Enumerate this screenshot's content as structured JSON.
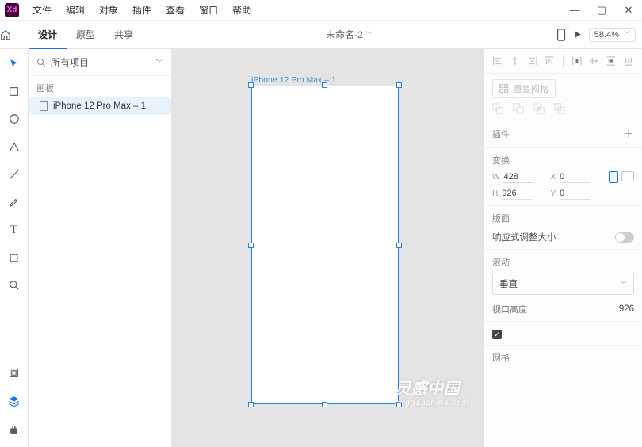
{
  "app_badge": "Xd",
  "menu": {
    "file": "文件",
    "edit": "编辑",
    "object": "对象",
    "plugins": "插件",
    "view": "查看",
    "window": "窗口",
    "help": "帮助"
  },
  "modes": {
    "design": "设计",
    "prototype": "原型",
    "share": "共享"
  },
  "doc": {
    "name": "未命名-2"
  },
  "zoom": "58.4%",
  "layers": {
    "search_placeholder": "所有项目",
    "section": "画板",
    "artboard_name": "iPhone 12 Pro Max – 1"
  },
  "canvas": {
    "artboard_label": "iPhone 12 Pro Max – 1"
  },
  "props": {
    "repeat_grid": "重复网格",
    "plugins": "插件",
    "transform": "变换",
    "w_label": "W",
    "w_value": "428",
    "h_label": "H",
    "h_value": "926",
    "x_label": "X",
    "x_value": "0",
    "y_label": "Y",
    "y_value": "0",
    "layout": "版面",
    "responsive": "响应式调整大小",
    "scroll": "滚动",
    "scroll_value": "垂直",
    "viewport_label": "视口高度",
    "viewport_value": "926",
    "appearance": "网格"
  },
  "watermark": {
    "main": "灵感中国",
    "sub": "lingganchina.com"
  }
}
